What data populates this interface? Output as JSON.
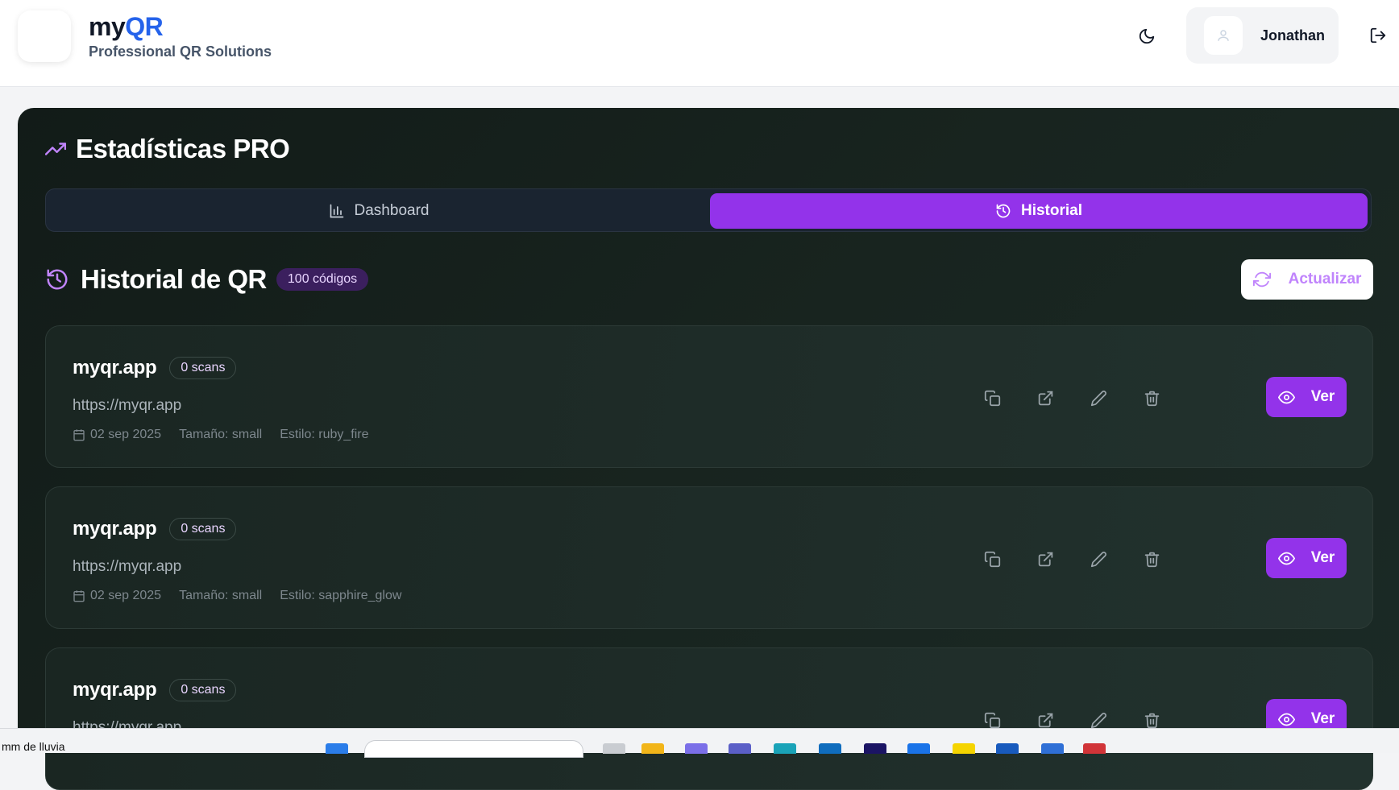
{
  "header": {
    "brand_my": "my",
    "brand_qr": "QR",
    "subtitle": "Professional QR Solutions",
    "user_name": "Jonathan"
  },
  "stats": {
    "title": "Estadísticas PRO",
    "tabs": [
      {
        "label": "Dashboard",
        "active": false
      },
      {
        "label": "Historial",
        "active": true
      }
    ]
  },
  "history": {
    "title": "Historial de QR",
    "count_badge": "100 códigos",
    "refresh_label": "Actualizar",
    "items": [
      {
        "name": "myqr.app",
        "scans": "0 scans",
        "url": "https://myqr.app",
        "date": "02 sep 2025",
        "size": "Tamaño: small",
        "style": "Estilo: ruby_fire",
        "view_label": "Ver"
      },
      {
        "name": "myqr.app",
        "scans": "0 scans",
        "url": "https://myqr.app",
        "date": "02 sep 2025",
        "size": "Tamaño: small",
        "style": "Estilo: sapphire_glow",
        "view_label": "Ver"
      },
      {
        "name": "myqr.app",
        "scans": "0 scans",
        "url": "https://myqr.app",
        "date": "",
        "size": "",
        "style": "",
        "view_label": "Ver"
      }
    ]
  },
  "taskbar": {
    "weather": "mm de lluvia"
  },
  "colors": {
    "accent": "#9333ea",
    "brand_blue": "#2563eb",
    "panel_bg": "#18241f"
  },
  "icons": [
    "moon-icon",
    "user-icon",
    "logout-icon",
    "trending-up-icon",
    "bar-chart-icon",
    "history-icon",
    "refresh-icon",
    "calendar-icon",
    "copy-icon",
    "external-link-icon",
    "edit-icon",
    "trash-icon",
    "eye-icon"
  ]
}
